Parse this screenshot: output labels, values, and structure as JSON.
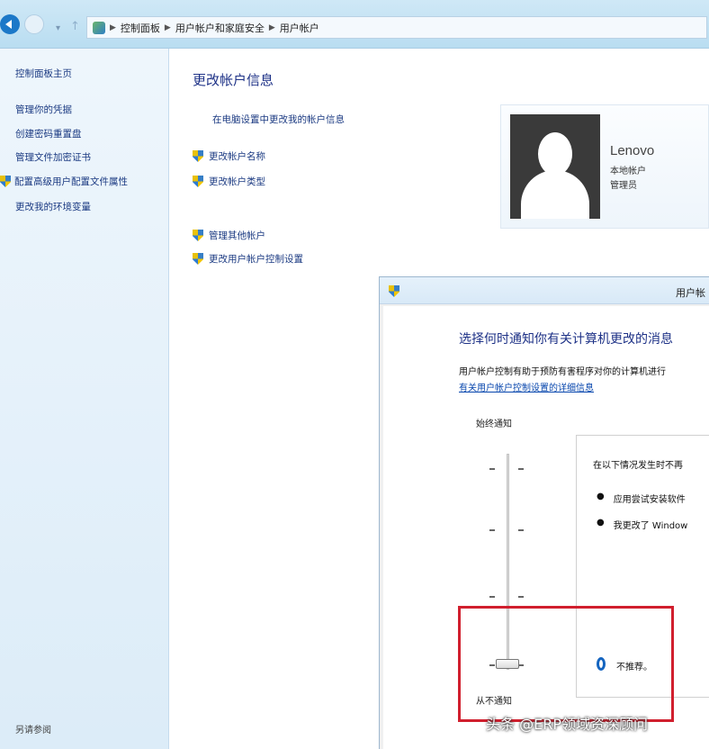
{
  "address_bar": {
    "breadcrumbs": [
      "控制面板",
      "用户帐户和家庭安全",
      "用户帐户"
    ]
  },
  "left_pane": {
    "home": "控制面板主页",
    "items": [
      "管理你的凭据",
      "创建密码重置盘",
      "管理文件加密证书",
      "配置高级用户配置文件属性",
      "更改我的环境变量"
    ],
    "bottom": [
      "另请参阅",
      ""
    ]
  },
  "main": {
    "title": "更改帐户信息",
    "pc_settings_link": "在电脑设置中更改我的帐户信息",
    "links": [
      "更改帐户名称",
      "更改帐户类型"
    ],
    "links2": [
      "管理其他帐户",
      "更改用户帐户控制设置"
    ]
  },
  "account": {
    "name": "Lenovo",
    "type": "本地帐户",
    "status": "管理员"
  },
  "uac_dialog": {
    "title": "用户帐",
    "heading": "选择何时通知你有关计算机更改的消息",
    "description": "用户帐户控制有助于预防有害程序对你的计算机进行",
    "more_link": "有关用户帐户控制设置的详细信息",
    "slider_top_label": "始终通知",
    "slider_bottom_label": "从不通知",
    "slider_level": 0,
    "info_heading": "在以下情况发生时不再",
    "info_bullets": [
      "应用尝试安装软件",
      "我更改了 Window"
    ],
    "recommendation": "不推荐。"
  },
  "watermark": "头条 @ERP领域资深顾问",
  "colors": {
    "link": "#1b3a82",
    "title": "#1e3287",
    "highlight": "#d11f2e"
  }
}
